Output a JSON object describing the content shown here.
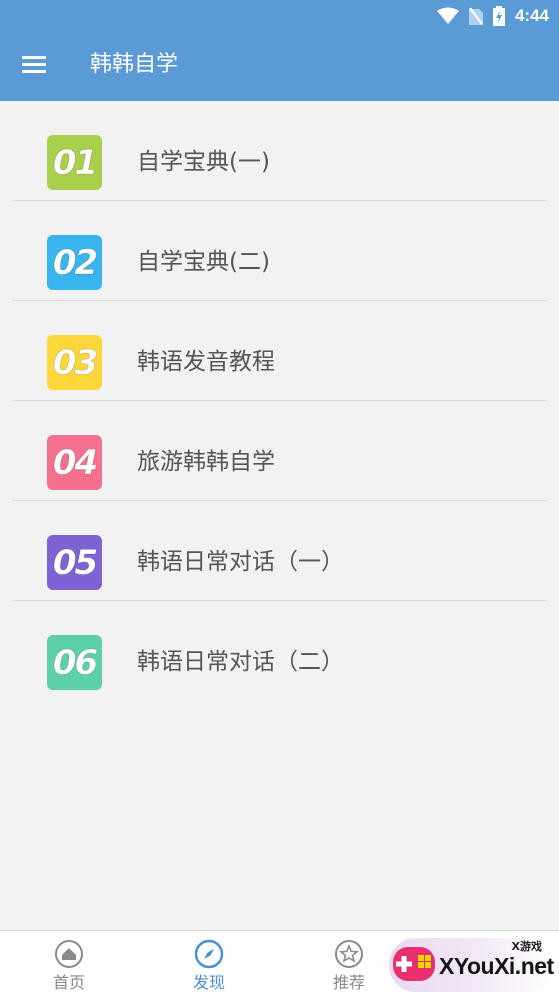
{
  "status_bar": {
    "time": "4:44",
    "icons": [
      "wifi-icon",
      "no-sim-icon",
      "battery-charging-icon"
    ]
  },
  "header": {
    "title": "韩韩自学",
    "menu_icon": "menu-icon",
    "bg_color": "#5b9bd5"
  },
  "list": {
    "items": [
      {
        "number": "01",
        "label": "自学宝典(一)",
        "color": "#a8d04a"
      },
      {
        "number": "02",
        "label": "自学宝典(二)",
        "color": "#39b4ee"
      },
      {
        "number": "03",
        "label": "韩语发音教程",
        "color": "#fbd73c"
      },
      {
        "number": "04",
        "label": "旅游韩韩自学",
        "color": "#f3718f"
      },
      {
        "number": "05",
        "label": "韩语日常对话（一）",
        "color": "#7f62d4"
      },
      {
        "number": "06",
        "label": "韩语日常对话（二）",
        "color": "#5ed0a9"
      }
    ]
  },
  "tabbar": {
    "tabs": [
      {
        "label": "首页",
        "icon": "home-icon",
        "active": false
      },
      {
        "label": "发现",
        "icon": "compass-icon",
        "active": true
      },
      {
        "label": "推荐",
        "icon": "star-icon",
        "active": false
      }
    ],
    "active_color": "#4a90d9"
  },
  "watermark": {
    "small_text": "X游戏",
    "text": "XYouXi.net"
  }
}
